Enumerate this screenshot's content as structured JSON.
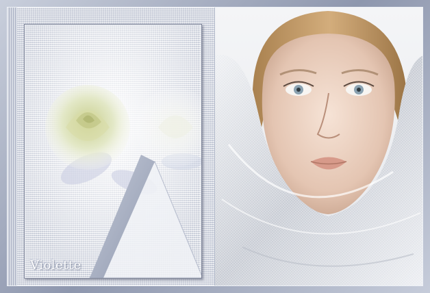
{
  "signature": {
    "text": "Violette"
  },
  "colors": {
    "frame": "#9aa2b6",
    "panel": "#e6e9ef",
    "rose": "#e9edcf",
    "skin": "#e9cdbc",
    "hair": "#c79b6a",
    "scarf": "#dfe2e6"
  },
  "scene": {
    "left": "rose-card-collage",
    "right": "woman-portrait-with-scarf"
  }
}
